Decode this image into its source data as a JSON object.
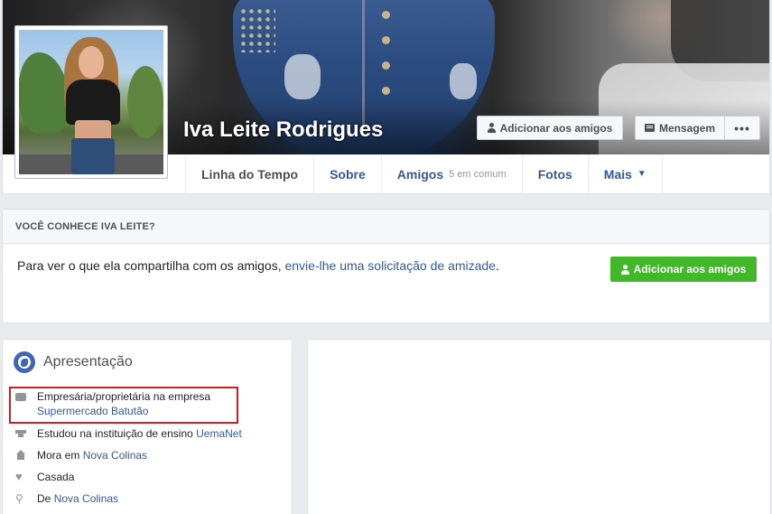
{
  "profile": {
    "name": "Iva Leite Rodrigues"
  },
  "actions": {
    "add_friend": "Adicionar aos amigos",
    "message": "Mensagem",
    "more": "•••"
  },
  "tabs": [
    {
      "label": "Linha do Tempo"
    },
    {
      "label": "Sobre"
    },
    {
      "label": "Amigos",
      "sub": "5 em comum"
    },
    {
      "label": "Fotos"
    },
    {
      "label": "Mais",
      "caret": "▼"
    }
  ],
  "know_card": {
    "heading": "VOCÊ CONHECE IVA LEITE?",
    "text_before": "Para ver o que ela compartilha com os amigos, ",
    "link": "envie-lhe uma solicitação de amizade",
    "text_after": ".",
    "button": "Adicionar aos amigos"
  },
  "intro": {
    "title": "Apresentação",
    "items": [
      {
        "icon": "briefcase-icon",
        "text": "Empresária/proprietária na empresa",
        "link": "Supermercado Batutão"
      },
      {
        "icon": "graduation-cap-icon",
        "text": "Estudou na instituição de ensino ",
        "link": "UemaNet"
      },
      {
        "icon": "house-icon",
        "text": "Mora em ",
        "link": "Nova Colinas"
      },
      {
        "icon": "heart-icon",
        "text": "Casada",
        "link": ""
      },
      {
        "icon": "map-pin-icon",
        "text": "De ",
        "link": "Nova Colinas"
      }
    ]
  },
  "colors": {
    "link": "#365899",
    "green": "#42b72a",
    "highlight": "#d11e25",
    "background": "#e9ebee"
  }
}
